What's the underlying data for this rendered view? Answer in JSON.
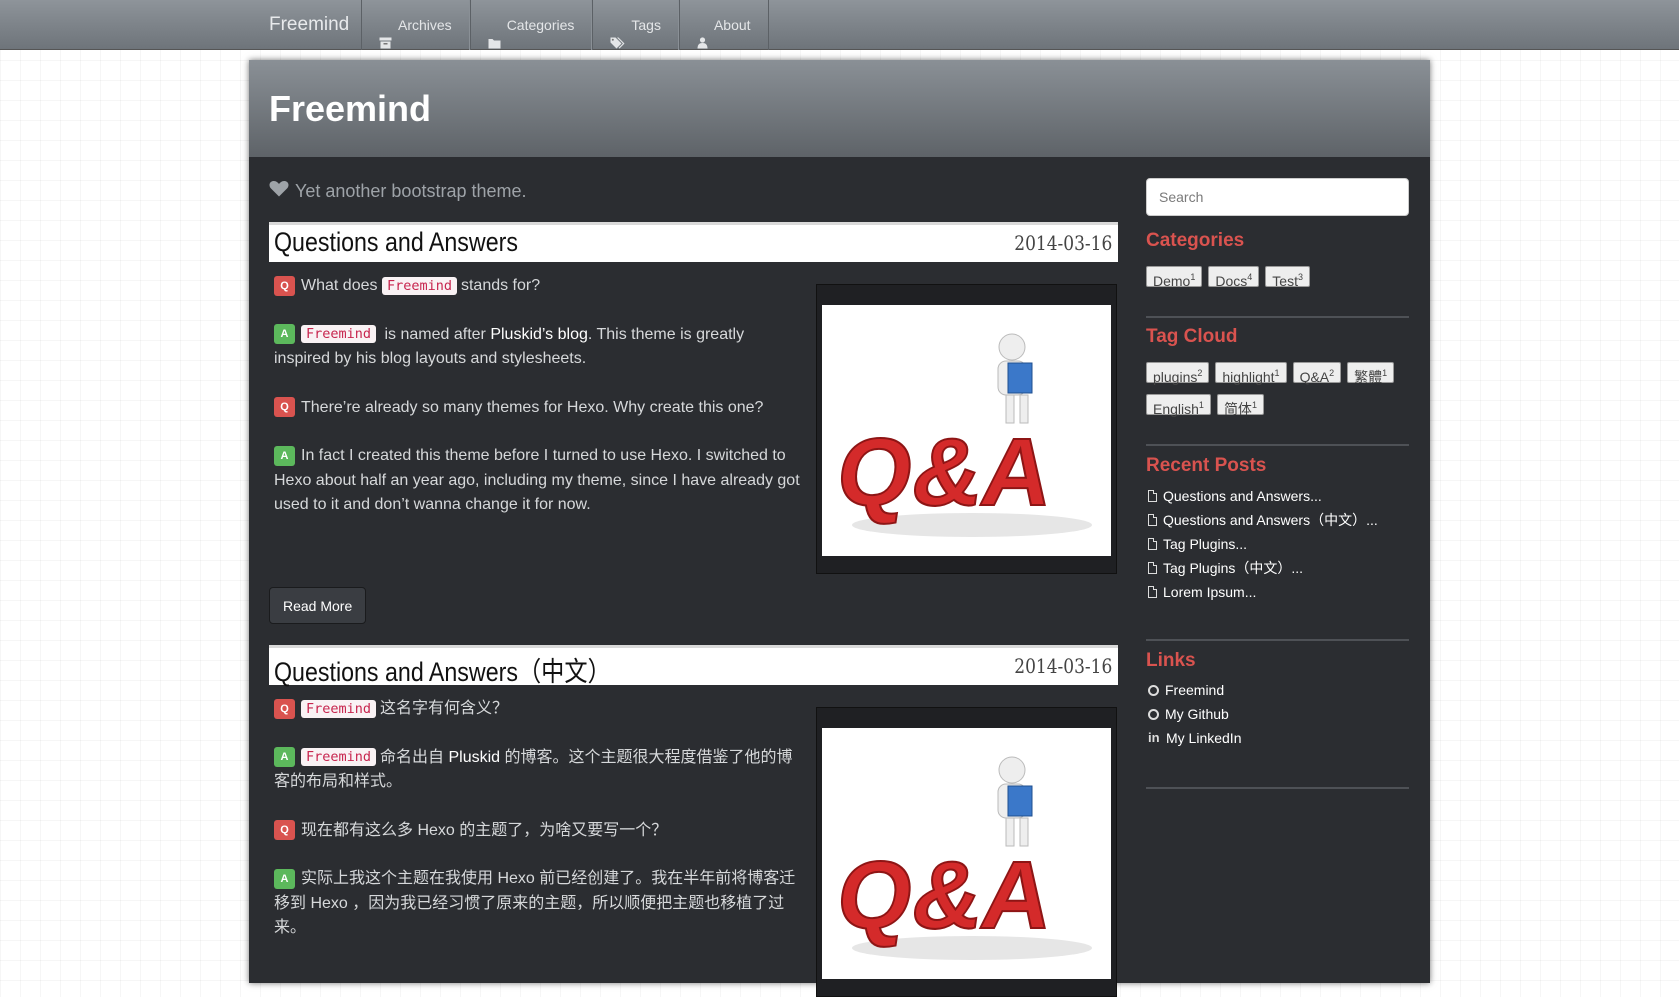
{
  "navbar": {
    "brand": "Freemind",
    "links": [
      {
        "label": "Archives",
        "icon": "archive-icon"
      },
      {
        "label": "Categories",
        "icon": "folder-icon"
      },
      {
        "label": "Tags",
        "icon": "tags-icon"
      },
      {
        "label": "About",
        "icon": "user-icon"
      }
    ]
  },
  "header": {
    "title": "Freemind",
    "tagline": "Yet another bootstrap theme."
  },
  "posts": [
    {
      "title": "Questions and Answers",
      "date": "2014-03-16",
      "q1_badge": "Q",
      "q1_code": "Freemind",
      "q1_pre": "What does",
      "q1_post": "stands for?",
      "a1_badge": "A",
      "a1_code": "Freemind",
      "a1_pre": "is named after",
      "a1_link": "Pluskid’s blog",
      "a1_post": ". This theme is greatly inspired by his blog layouts and stylesheets.",
      "q2_badge": "Q",
      "q2_text": "There’re already so many themes for Hexo. Why create this one?",
      "a2_badge": "A",
      "a2_text": "In fact I created this theme before I turned to use Hexo. I switched to Hexo about half an year ago, including my theme, since I have already got used to it and don’t wanna change it for now.",
      "read_more": "Read More"
    },
    {
      "title": "Questions and Answers（中文）",
      "date": "2014-03-16",
      "q1_badge": "Q",
      "q1_code": "Freemind",
      "q1_post": "这名字有何含义？",
      "a1_badge": "A",
      "a1_code": "Freemind",
      "a1_pre": "命名出自",
      "a1_link": "Pluskid",
      "a1_post": "的博客。这个主题很大程度借鉴了他的博客的布局和样式。",
      "q2_badge": "Q",
      "q2_text": "现在都有这么多 Hexo 的主题了，为啥又要写一个？",
      "a2_badge": "A",
      "a2_text": "实际上我这个主题在我使用 Hexo 前已经创建了。我在半年前将博客迁移到 Hexo ，因为我已经习惯了原来的主题，所以顺便把主题也移植了过来。"
    }
  ],
  "thumbnail_text": "Q&A",
  "sidebar": {
    "search_placeholder": "Search",
    "categories_heading": "Categories",
    "categories": [
      {
        "name": "Demo",
        "count": "1"
      },
      {
        "name": "Docs",
        "count": "4"
      },
      {
        "name": "Test",
        "count": "3"
      }
    ],
    "tagcloud_heading": "Tag Cloud",
    "tags_row1": [
      {
        "name": "plugins",
        "count": "2"
      },
      {
        "name": "highlight",
        "count": "1"
      },
      {
        "name": "Q&A",
        "count": "2"
      },
      {
        "name": "繁體",
        "count": "1"
      }
    ],
    "tags_row2": [
      {
        "name": "English",
        "count": "1"
      },
      {
        "name": "简体",
        "count": "1"
      }
    ],
    "recent_heading": "Recent Posts",
    "recent_posts": [
      "Questions and Answers...",
      "Questions and Answers（中文）...",
      "Tag Plugins...",
      "Tag Plugins（中文）...",
      "Lorem Ipsum..."
    ],
    "links_heading": "Links",
    "links": [
      {
        "label": "Freemind",
        "icon": "github-icon"
      },
      {
        "label": "My Github",
        "icon": "github-icon"
      },
      {
        "label": "My LinkedIn",
        "icon": "linkedin-icon"
      }
    ]
  },
  "colors": {
    "accent": "#d9534f",
    "answer": "#5cb85c",
    "background": "#2b2d31"
  }
}
